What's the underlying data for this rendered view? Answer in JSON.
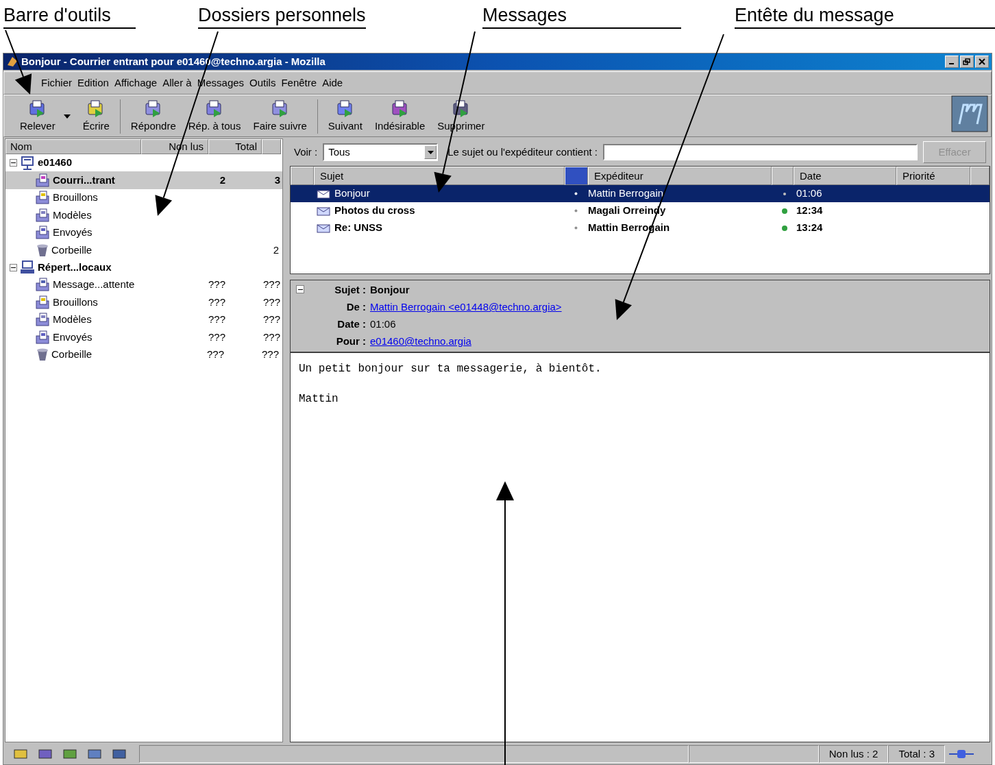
{
  "annotations": [
    {
      "label": "Barre d'outils"
    },
    {
      "label": "Dossiers personnels"
    },
    {
      "label": "Messages"
    },
    {
      "label": "Entête du message"
    }
  ],
  "window": {
    "title": "Bonjour - Courrier entrant pour e01460@techno.argia - Mozilla"
  },
  "menu": [
    "Fichier",
    "Edition",
    "Affichage",
    "Aller à",
    "Messages",
    "Outils",
    "Fenêtre",
    "Aide"
  ],
  "toolbar": [
    {
      "label": "Relever",
      "kind": "get",
      "dropdown": true
    },
    {
      "label": "Écrire",
      "kind": "write",
      "dropdown": false
    },
    {
      "label": "Répondre",
      "kind": "reply",
      "dropdown": false
    },
    {
      "label": "Rép. à tous",
      "kind": "replyall",
      "dropdown": false
    },
    {
      "label": "Faire suivre",
      "kind": "forward",
      "dropdown": false
    },
    {
      "label": "Suivant",
      "kind": "next",
      "dropdown": false
    },
    {
      "label": "Indésirable",
      "kind": "junk",
      "dropdown": false
    },
    {
      "label": "Supprimer",
      "kind": "delete",
      "dropdown": false
    }
  ],
  "folder_pane": {
    "columns": [
      "Nom",
      "Non lus",
      "Total"
    ],
    "tree": [
      {
        "name": "e01460",
        "kind": "account",
        "expanded": true,
        "children": [
          {
            "name": "Courri...trant",
            "kind": "inbox",
            "unread": "2",
            "total": "3",
            "bold": true,
            "selected": true
          },
          {
            "name": "Brouillons",
            "kind": "drafts",
            "bold": false,
            "selected": false
          },
          {
            "name": "Modèles",
            "kind": "templates",
            "bold": false,
            "selected": false
          },
          {
            "name": "Envoyés",
            "kind": "sent",
            "bold": false,
            "selected": false
          },
          {
            "name": "Corbeille",
            "kind": "trash",
            "total": "2",
            "bold": false,
            "selected": false
          }
        ]
      },
      {
        "name": "Répert...locaux",
        "kind": "local",
        "expanded": true,
        "children": [
          {
            "name": "Message...attente",
            "kind": "outbox",
            "unread": "???",
            "total": "???",
            "bold": false,
            "selected": false
          },
          {
            "name": "Brouillons",
            "kind": "drafts",
            "unread": "???",
            "total": "???",
            "bold": false,
            "selected": false
          },
          {
            "name": "Modèles",
            "kind": "templates",
            "unread": "???",
            "total": "???",
            "bold": false,
            "selected": false
          },
          {
            "name": "Envoyés",
            "kind": "sent",
            "unread": "???",
            "total": "???",
            "bold": false,
            "selected": false
          },
          {
            "name": "Corbeille",
            "kind": "trash",
            "unread": "???",
            "total": "???",
            "bold": false,
            "selected": false
          }
        ]
      }
    ]
  },
  "filter": {
    "view_label": "Voir :",
    "view_value": "Tous",
    "search_label": "Le sujet ou l'expéditeur contient :",
    "clear_button": "Effacer",
    "clear_disabled": true
  },
  "message_list": {
    "columns": [
      "Sujet",
      "Expéditeur",
      "Date",
      "Priorité"
    ],
    "rows": [
      {
        "subject": "Bonjour",
        "sender": "Mattin Berrogain",
        "date": "01:06",
        "unread": false,
        "selected": true
      },
      {
        "subject": "Photos du cross",
        "sender": "Magali Orreindy",
        "date": "12:34",
        "unread": true,
        "selected": false
      },
      {
        "subject": "Re: UNSS",
        "sender": "Mattin Berrogain",
        "date": "13:24",
        "unread": true,
        "selected": false
      }
    ]
  },
  "message_header": {
    "expanded": true,
    "fields": [
      {
        "label": "Sujet :",
        "value": "Bonjour",
        "kind": "bold"
      },
      {
        "label": "De :",
        "value": "Mattin Berrogain <e01448@techno.argia>",
        "kind": "link"
      },
      {
        "label": "Date :",
        "value": "01:06",
        "kind": "text"
      },
      {
        "label": "Pour :",
        "value": "e01460@techno.argia",
        "kind": "link"
      }
    ]
  },
  "message_body": [
    "Un petit bonjour sur ta messagerie, à bientôt.",
    "Mattin"
  ],
  "status_bar": {
    "unread": "Non lus : 2",
    "total": "Total : 3"
  }
}
